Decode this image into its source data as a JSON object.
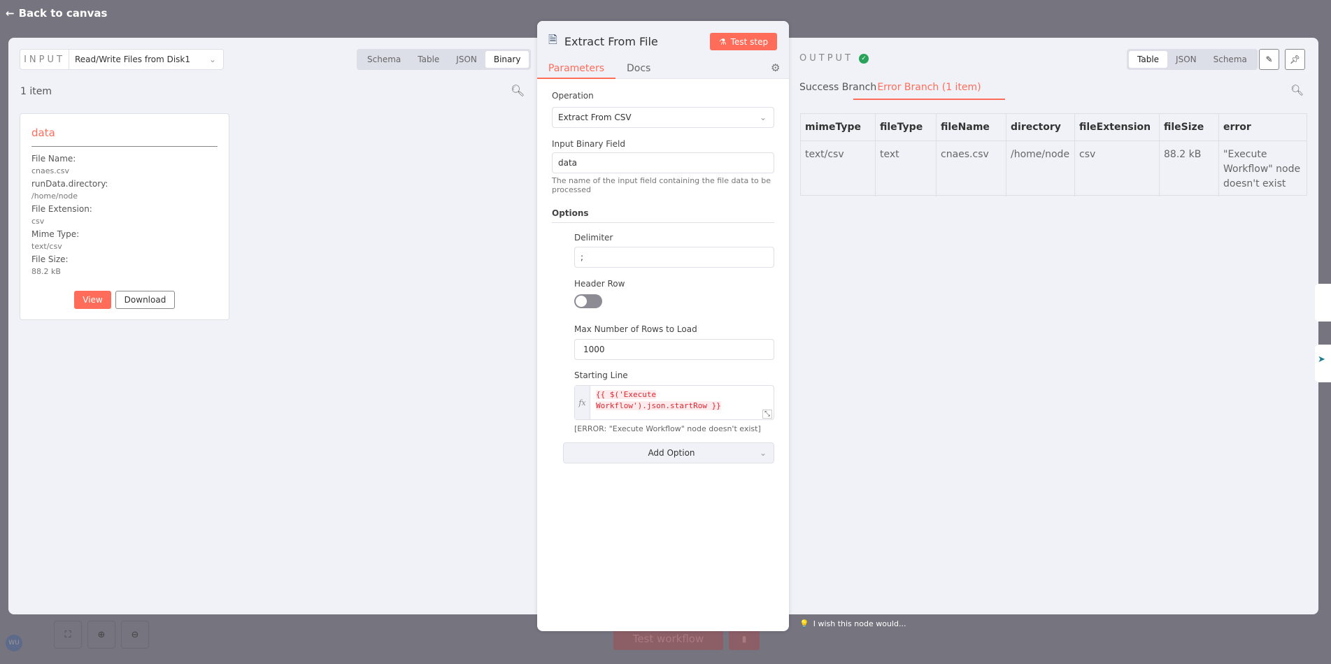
{
  "back_label": "Back to canvas",
  "input": {
    "label": "INPUT",
    "node": "Read/Write Files from Disk1",
    "tabs": [
      "Schema",
      "Table",
      "JSON",
      "Binary"
    ],
    "active_tab": "Binary",
    "count": "1 item",
    "card": {
      "title": "data",
      "fields": [
        {
          "k": "File Name:",
          "v": "cnaes.csv"
        },
        {
          "k": "runData.directory:",
          "v": "/home/node"
        },
        {
          "k": "File Extension:",
          "v": "csv"
        },
        {
          "k": "Mime Type:",
          "v": "text/csv"
        },
        {
          "k": "File Size:",
          "v": "88.2 kB"
        }
      ],
      "view": "View",
      "download": "Download"
    }
  },
  "node": {
    "title": "Extract From File",
    "test_step": "Test step",
    "tabs": [
      "Parameters",
      "Docs"
    ],
    "operation_label": "Operation",
    "operation": "Extract From CSV",
    "binary_label": "Input Binary Field",
    "binary_value": "data",
    "binary_hint": "The name of the input field containing the file data to be processed",
    "options_label": "Options",
    "delimiter_label": "Delimiter",
    "delimiter": ";",
    "header_label": "Header Row",
    "header_row": false,
    "maxrows_label": "Max Number of Rows to Load",
    "maxrows": "1000",
    "start_label": "Starting Line",
    "fx": "fx",
    "expr1": "{{ $('Execute",
    "expr2": "Workflow').json.startRow }}",
    "error": "[ERROR: \"Execute Workflow\" node doesn't exist]",
    "add_option": "Add Option"
  },
  "output": {
    "label": "OUTPUT",
    "tabs": [
      "Table",
      "JSON",
      "Schema"
    ],
    "active_tab": "Table",
    "branches": [
      "Success Branch",
      "Error Branch (1 item)"
    ],
    "active_branch": "Error Branch (1 item)",
    "columns": [
      "mimeType",
      "fileType",
      "fileName",
      "directory",
      "fileExtension",
      "fileSize",
      "error"
    ],
    "rows": [
      [
        "text/csv",
        "text",
        "cnaes.csv",
        "/home/node",
        "csv",
        "88.2 kB",
        "\"Execute Workflow\" node doesn't exist"
      ]
    ]
  },
  "footer": {
    "feedback": "I wish this node would...",
    "test_workflow": "Test workflow",
    "avatar": "WU"
  },
  "colors": {
    "accent": "#ff6d5a",
    "success": "#29a35c",
    "overlay": "#76747f"
  }
}
